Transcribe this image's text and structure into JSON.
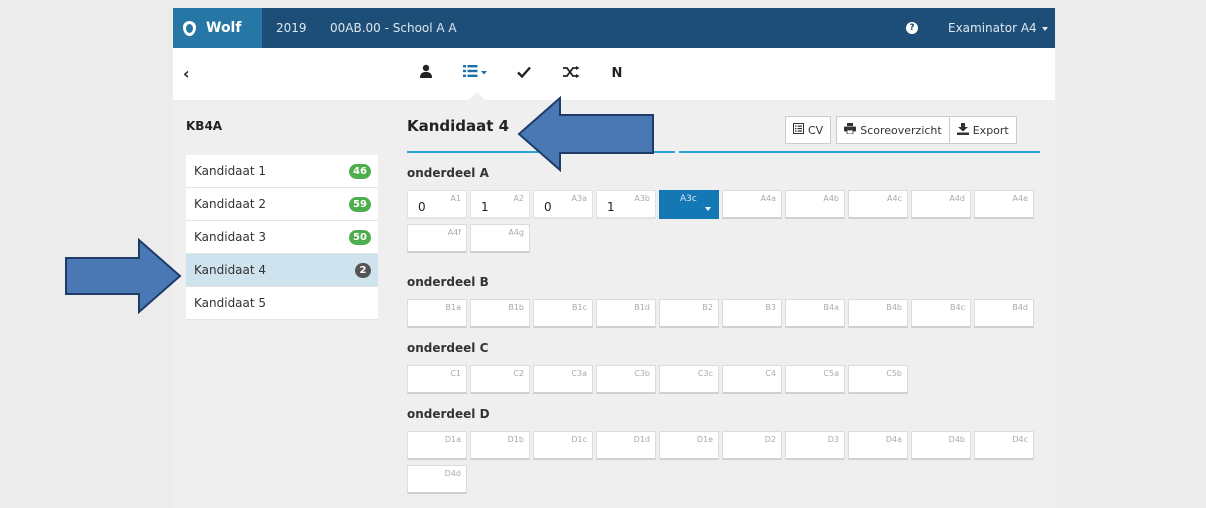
{
  "topbar": {
    "brand": "Wolf",
    "year": "2019",
    "school": "00AB.00 - School A A",
    "help_icon": "question-circle-icon",
    "user": "Examinator A4"
  },
  "navbar": {
    "back_icon": "chevron-left-icon",
    "icons": [
      "person-icon",
      "list-icon",
      "check-icon",
      "shuffle-icon",
      "n-icon"
    ],
    "n_label": "N"
  },
  "sidebar": {
    "class_name": "KB4A",
    "students": [
      {
        "name": "Kandidaat 1",
        "badge": "46",
        "active": false
      },
      {
        "name": "Kandidaat 2",
        "badge": "59",
        "active": false
      },
      {
        "name": "Kandidaat 3",
        "badge": "50",
        "active": false
      },
      {
        "name": "Kandidaat 4",
        "badge": "2",
        "active": true
      },
      {
        "name": "Kandidaat 5",
        "badge": "",
        "active": false
      }
    ]
  },
  "main": {
    "title": "Kandidaat 4",
    "buttons": {
      "cv": "CV",
      "score": "Scoreoverzicht",
      "export": "Export"
    },
    "sections": [
      {
        "label": "onderdeel A",
        "cells": [
          {
            "code": "A1",
            "score": "0"
          },
          {
            "code": "A2",
            "score": "1"
          },
          {
            "code": "A3a",
            "score": "0"
          },
          {
            "code": "A3b",
            "score": "1"
          },
          {
            "code": "A3c",
            "score": "",
            "selected": true
          },
          {
            "code": "A4a",
            "score": ""
          },
          {
            "code": "A4b",
            "score": ""
          },
          {
            "code": "A4c",
            "score": ""
          },
          {
            "code": "A4d",
            "score": ""
          },
          {
            "code": "A4e",
            "score": ""
          },
          {
            "code": "A4f",
            "score": ""
          },
          {
            "code": "A4g",
            "score": ""
          }
        ]
      },
      {
        "label": "onderdeel B",
        "cells": [
          {
            "code": "B1a"
          },
          {
            "code": "B1b"
          },
          {
            "code": "B1c"
          },
          {
            "code": "B1d"
          },
          {
            "code": "B2"
          },
          {
            "code": "B3"
          },
          {
            "code": "B4a"
          },
          {
            "code": "B4b"
          },
          {
            "code": "B4c"
          },
          {
            "code": "B4d"
          }
        ]
      },
      {
        "label": "onderdeel C",
        "cells": [
          {
            "code": "C1"
          },
          {
            "code": "C2"
          },
          {
            "code": "C3a"
          },
          {
            "code": "C3b"
          },
          {
            "code": "C3c"
          },
          {
            "code": "C4"
          },
          {
            "code": "C5a"
          },
          {
            "code": "C5b"
          }
        ]
      },
      {
        "label": "onderdeel D",
        "cells": [
          {
            "code": "D1a"
          },
          {
            "code": "D1b"
          },
          {
            "code": "D1c"
          },
          {
            "code": "D1d"
          },
          {
            "code": "D1e"
          },
          {
            "code": "D2"
          },
          {
            "code": "D3"
          },
          {
            "code": "D4a"
          },
          {
            "code": "D4b"
          },
          {
            "code": "D4c"
          },
          {
            "code": "D4d"
          }
        ]
      }
    ]
  },
  "colors": {
    "topbar": "#1c4e77",
    "brand": "#2777a6",
    "accent": "#2fa3d4",
    "selected_cell": "#1478b5",
    "badge_green": "#4cae4c",
    "arrow_fill": "#4a78b5",
    "arrow_stroke": "#1f3b66"
  }
}
